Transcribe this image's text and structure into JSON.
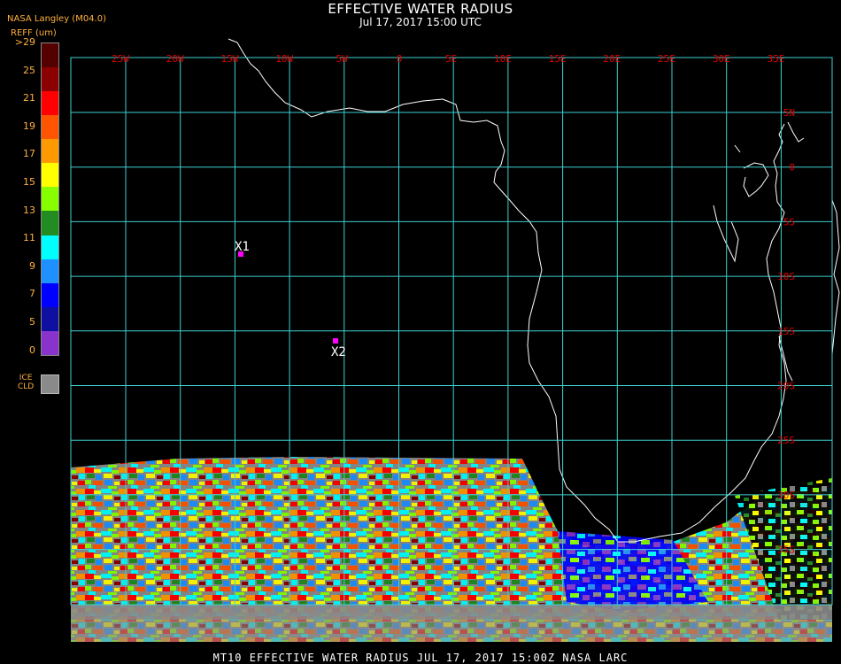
{
  "header": {
    "title": "EFFECTIVE WATER RADIUS",
    "subtitle": "Jul 17, 2017 15:00 UTC",
    "provider": "NASA Langley (M04.0)"
  },
  "colorbar": {
    "title": "REFF (um)",
    "labels": [
      ">29",
      "25",
      "21",
      "19",
      "17",
      "15",
      "13",
      "11",
      "9",
      "7",
      "5",
      "0"
    ],
    "colors": [
      "#550000",
      "#8b0000",
      "#ff0000",
      "#ff5500",
      "#ff9900",
      "#ffff00",
      "#88ff00",
      "#228b22",
      "#00ffff",
      "#1e90ff",
      "#0000ff",
      "#1010a0",
      "#8833cc"
    ],
    "ice_label_line1": "ICE",
    "ice_label_line2": "CLD",
    "ice_color": "#8a8a8a"
  },
  "grid": {
    "lon_labels": [
      "25W",
      "20W",
      "15W",
      "10W",
      "5W",
      "0",
      "5E",
      "10E",
      "15E",
      "20E",
      "25E",
      "30E",
      "35E"
    ],
    "lat_labels": [
      "5N",
      "0",
      "5S",
      "10S",
      "15S",
      "20S",
      "25S",
      "30S",
      "35S"
    ],
    "line_color": "#40d0d0",
    "label_color": "#e00000"
  },
  "markers": [
    {
      "label": "X1",
      "color": "#ff00ff"
    },
    {
      "label": "X2",
      "color": "#ff00ff"
    }
  ],
  "footer": "MT10  EFFECTIVE WATER RADIUS  JUL 17, 2017 15:00Z  NASA LARC"
}
